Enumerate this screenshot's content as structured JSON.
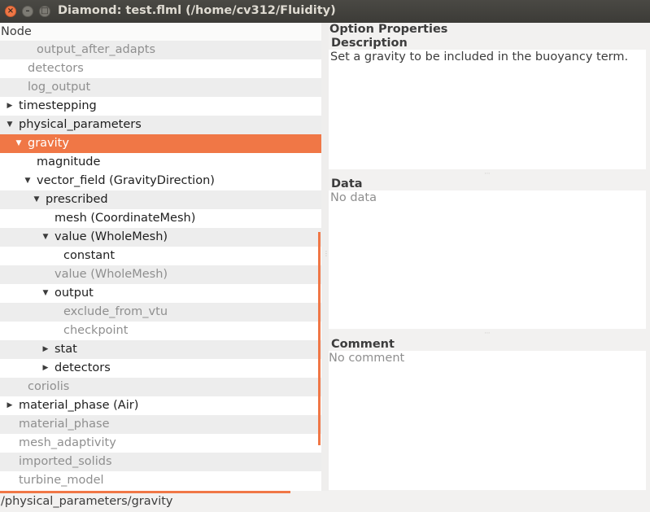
{
  "window": {
    "title": "Diamond: test.flml (/home/cv312/Fluidity)",
    "close_glyph": "×",
    "min_glyph": "–",
    "max_glyph": "□"
  },
  "tree": {
    "header": "Node",
    "rows": [
      {
        "label": "output_after_adapts",
        "expander": "",
        "style": "grey"
      },
      {
        "label": "detectors",
        "expander": "",
        "style": "grey"
      },
      {
        "label": "log_output",
        "expander": "",
        "style": "grey"
      },
      {
        "label": "timestepping",
        "expander": "▶",
        "style": "dark"
      },
      {
        "label": "physical_parameters",
        "expander": "▼",
        "style": "dark"
      },
      {
        "label": "gravity",
        "expander": "▼",
        "style": "selected"
      },
      {
        "label": "magnitude",
        "expander": "",
        "style": "dark"
      },
      {
        "label": "vector_field (GravityDirection)",
        "expander": "▼",
        "style": "dark"
      },
      {
        "label": "prescribed",
        "expander": "▼",
        "style": "dark"
      },
      {
        "label": "mesh (CoordinateMesh)",
        "expander": "",
        "style": "dark"
      },
      {
        "label": "value (WholeMesh)",
        "expander": "▼",
        "style": "dark"
      },
      {
        "label": "constant",
        "expander": "",
        "style": "dark"
      },
      {
        "label": "value (WholeMesh)",
        "expander": "",
        "style": "grey"
      },
      {
        "label": "output",
        "expander": "▼",
        "style": "dark"
      },
      {
        "label": "exclude_from_vtu",
        "expander": "",
        "style": "grey"
      },
      {
        "label": "checkpoint",
        "expander": "",
        "style": "grey"
      },
      {
        "label": "stat",
        "expander": "▶",
        "style": "dark"
      },
      {
        "label": "detectors",
        "expander": "▶",
        "style": "dark"
      },
      {
        "label": "coriolis",
        "expander": "",
        "style": "grey"
      },
      {
        "label": "material_phase (Air)",
        "expander": "▶",
        "style": "dark"
      },
      {
        "label": "material_phase",
        "expander": "",
        "style": "grey"
      },
      {
        "label": "mesh_adaptivity",
        "expander": "",
        "style": "grey"
      },
      {
        "label": "imported_solids",
        "expander": "",
        "style": "grey"
      },
      {
        "label": "turbine_model",
        "expander": "",
        "style": "grey"
      }
    ]
  },
  "status_bar": {
    "path": "/physical_parameters/gravity"
  },
  "properties": {
    "title": "Option Properties",
    "description_label": "Description",
    "description_text": "Set a gravity to be included in the buoyancy term.",
    "data_label": "Data",
    "data_text": "No data",
    "comment_label": "Comment",
    "comment_text": "No comment"
  },
  "colors": {
    "accent": "#f07746",
    "titlebar": "#3c3b37"
  }
}
